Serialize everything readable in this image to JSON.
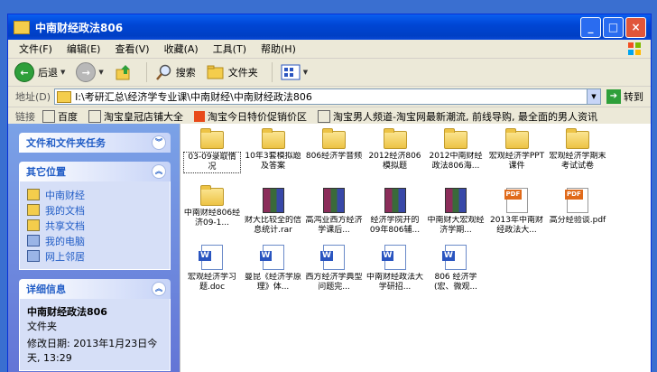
{
  "window": {
    "title": "中南财经政法806",
    "min": "_",
    "max": "□",
    "close": "×"
  },
  "menu": [
    "文件(F)",
    "编辑(E)",
    "查看(V)",
    "收藏(A)",
    "工具(T)",
    "帮助(H)"
  ],
  "toolbar": {
    "back": "后退",
    "search": "搜索",
    "folders": "文件夹"
  },
  "address": {
    "label": "地址(D)",
    "path": "I:\\考研汇总\\经济学专业课\\中南财经\\中南财经政法806",
    "go": "转到"
  },
  "links": {
    "label": "链接",
    "items": [
      {
        "label": "百度",
        "icon": "page"
      },
      {
        "label": "淘宝皇冠店铺大全",
        "icon": "page"
      },
      {
        "label": "淘宝今日特价促销价区",
        "icon": "taobao"
      },
      {
        "label": "淘宝男人频道-淘宝网最新潮流, 前线导购, 最全面的男人资讯",
        "icon": "page"
      }
    ]
  },
  "sidebar": {
    "tasks_title": "文件和文件夹任务",
    "other_title": "其它位置",
    "places": [
      "中南财经",
      "我的文档",
      "共享文档",
      "我的电脑",
      "网上邻居"
    ],
    "details_title": "详细信息",
    "details": {
      "name": "中南财经政法806",
      "type": "文件夹",
      "modified": "修改日期: 2013年1月23日今天, 13:29"
    }
  },
  "files": [
    {
      "name": "03-09录取情况",
      "kind": "folder"
    },
    {
      "name": "10年3套模拟题及答案",
      "kind": "folder"
    },
    {
      "name": "806经济学音频",
      "kind": "folder"
    },
    {
      "name": "2012经济806模拟题",
      "kind": "folder"
    },
    {
      "name": "2012中南财经政法806海...",
      "kind": "folder"
    },
    {
      "name": "宏观经济学PPT课件",
      "kind": "folder"
    },
    {
      "name": "宏观经济学期末考试试卷",
      "kind": "folder"
    },
    {
      "name": "中南财经806经济09-1...",
      "kind": "folder"
    },
    {
      "name": "财大比较全的信息统计.rar",
      "kind": "rar"
    },
    {
      "name": "高鸿业西方经济学课后...",
      "kind": "rar"
    },
    {
      "name": "经济学院开的09年806辅...",
      "kind": "rar"
    },
    {
      "name": "中南财大宏观经济学期...",
      "kind": "rar"
    },
    {
      "name": "2013年中南财经政法大...",
      "kind": "pdf"
    },
    {
      "name": "高分经验谈.pdf",
      "kind": "pdf"
    },
    {
      "name": "宏观经济学习题.doc",
      "kind": "doc"
    },
    {
      "name": "曼昆《经济学原理》体...",
      "kind": "doc"
    },
    {
      "name": "西方经济学典型问题完...",
      "kind": "doc"
    },
    {
      "name": "中南财经政法大学研招...",
      "kind": "doc"
    },
    {
      "name": "806 经济学(宏、微观...",
      "kind": "doc"
    }
  ]
}
